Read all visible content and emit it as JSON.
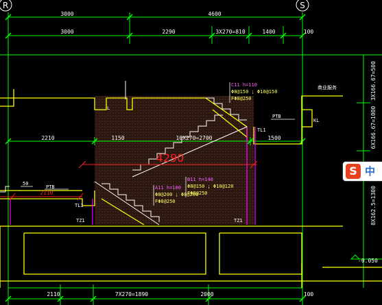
{
  "axes": {
    "left": "R",
    "right": "S"
  },
  "top_dims_1": [
    "3000",
    "4600"
  ],
  "top_dims_2": [
    "3000",
    "2290",
    "3X270=810",
    "1400",
    "100"
  ],
  "mid_dims": [
    "2210",
    "1150",
    "10X270=2700",
    "1500"
  ],
  "bottom_dims": [
    "2110",
    "7X270=1890",
    "2000",
    "100"
  ],
  "right_dims": [
    "3X166.67=500",
    "6X166.67=1000",
    "8X162.5=1300"
  ],
  "level": "-0.050",
  "room_label": "商业服务",
  "big_dim": "4290",
  "left_dim": "2110",
  "labels": {
    "pt_upper": "PTB",
    "pt_lower": "PTB",
    "kl": "KL",
    "l_upper": "L",
    "tl_upper": "TL1",
    "tl_lower": "TL1",
    "tz_left": "TZ1",
    "tz_right": "TZ1",
    "fifty": "50"
  },
  "stairs": {
    "c": {
      "name": "C11 h=110",
      "rebar1": "Φ8@150 ; Φ10@150",
      "rebar2": "FΦ8@250"
    },
    "b": {
      "name": "B11 h=140",
      "rebar1": "Φ8@150 ; Φ10@120",
      "rebar2": "FΦ8@250"
    },
    "a": {
      "name": "A11 h=100",
      "rebar1": "Φ8@200 ; Φ8@200",
      "rebar2": "FΦ8@250"
    }
  },
  "colors": {
    "dim": "#00ff00",
    "wall": "#ffff00",
    "stair": "#ffffff",
    "beam": "#ff00ff",
    "red": "#ff2020",
    "room": "#ffffff"
  },
  "ime": {
    "s": "S",
    "zh": "中"
  }
}
